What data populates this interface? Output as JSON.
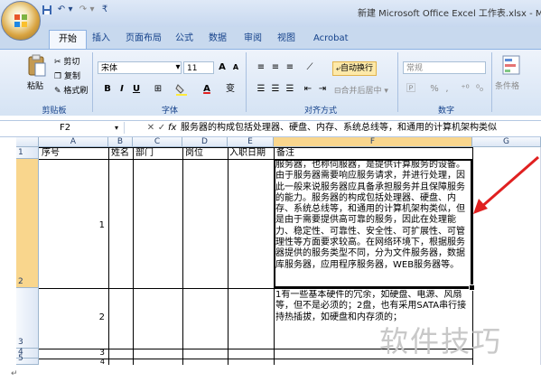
{
  "window": {
    "title": "新建 Microsoft Office Excel 工作表.xlsx - M"
  },
  "tabs": [
    {
      "label": "开始"
    },
    {
      "label": "插入"
    },
    {
      "label": "页面布局"
    },
    {
      "label": "公式"
    },
    {
      "label": "数据"
    },
    {
      "label": "审阅"
    },
    {
      "label": "视图"
    },
    {
      "label": "Acrobat"
    }
  ],
  "ribbon": {
    "clipboard": {
      "paste": "粘贴",
      "cut": "剪切",
      "copy": "复制",
      "format_painter": "格式刷",
      "label": "剪贴板"
    },
    "font": {
      "name": "宋体",
      "size": "11",
      "bold": "B",
      "italic": "I",
      "underline": "U",
      "label": "字体"
    },
    "alignment": {
      "wrap_text": "自动换行",
      "merge_center": "合并后居中",
      "label": "对齐方式"
    },
    "number": {
      "format": "常规",
      "percent": "%",
      "comma": ",",
      "label": "数字"
    },
    "styles": {
      "conditional": "条件格"
    }
  },
  "formula_bar": {
    "name_box": "F2",
    "fx": "fx",
    "content": "服务器的构成包括处理器、硬盘、内存、系统总线等，和通用的计算机架构类似"
  },
  "columns": [
    "A",
    "B",
    "C",
    "D",
    "E",
    "F",
    "G"
  ],
  "row_numbers": [
    "1",
    "2",
    "3",
    "4",
    "5"
  ],
  "header_row": {
    "a": "序号",
    "b": "姓名",
    "c": "部门",
    "d": "岗位",
    "e": "入职日期",
    "f": "备注"
  },
  "rows": {
    "r2_a": "1",
    "r2_f": "服务器，也称伺服器，是提供计算服务的设备。由于服务器需要响应服务请求，并进行处理，因此一般来说服务器应具备承担服务并且保障服务的能力。服务器的构成包括处理器、硬盘、内存、系统总线等，和通用的计算机架构类似，但是由于需要提供高可靠的服务，因此在处理能力、稳定性、可靠性、安全性、可扩展性、可管理性等方面要求较高。在网络环境下，根据服务器提供的服务类型不同，分为文件服务器，数据库服务器，应用程序服务器，WEB服务器等。",
    "r3_a": "2",
    "r3_f": "1有一些基本硬件的冗余，如硬盘、电源、风扇等，但不是必须的；2盘，也有采用SATA串行接持热插拔，如硬盘和内存须的；",
    "r4_a": "3",
    "r5_a": "4"
  },
  "watermark": "软件技巧",
  "colors": {
    "selected_header": "#f9d68d",
    "arrow": "#e02020",
    "ribbon_text": "#15428b"
  }
}
